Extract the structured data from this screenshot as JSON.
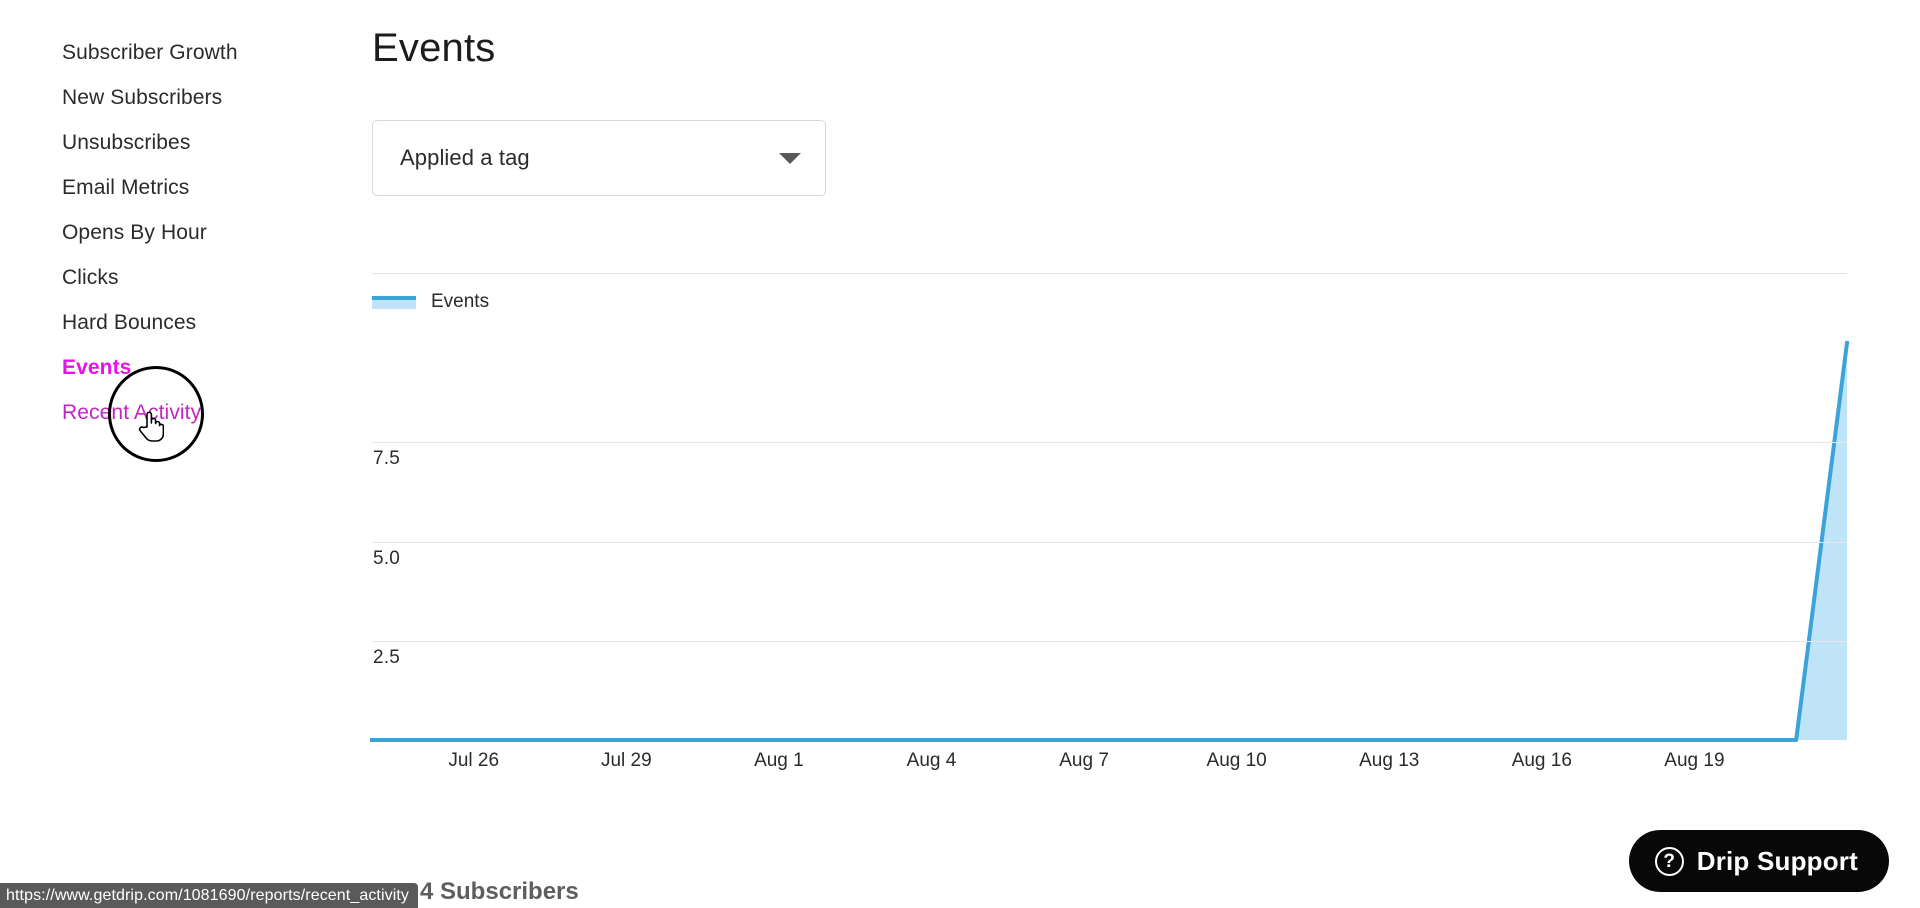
{
  "sidebar": {
    "items": [
      {
        "label": "Subscriber Growth",
        "state": "normal"
      },
      {
        "label": "New Subscribers",
        "state": "normal"
      },
      {
        "label": "Unsubscribes",
        "state": "normal"
      },
      {
        "label": "Email Metrics",
        "state": "normal"
      },
      {
        "label": "Opens By Hour",
        "state": "normal"
      },
      {
        "label": "Clicks",
        "state": "normal"
      },
      {
        "label": "Hard Bounces",
        "state": "normal"
      },
      {
        "label": "Events",
        "state": "active"
      },
      {
        "label": "Recent Activity",
        "state": "visited"
      }
    ]
  },
  "main": {
    "title": "Events",
    "filter": {
      "value": "Applied a tag",
      "caret_icon": "chevron-down-icon"
    }
  },
  "support": {
    "label": "Drip Support",
    "icon": "question-circle-icon",
    "glyph": "?"
  },
  "status": {
    "url": "https://www.getdrip.com/1081690/reports/recent_activity"
  },
  "background": {
    "ghost_text": "4 Subscribers"
  },
  "colors": {
    "accent_magenta": "#e612e6",
    "visited_magenta": "#c425c4",
    "line_blue": "#3aa3d9",
    "fill_blue": "#bfe4f7",
    "grid": "#e6e6e6",
    "support_bg": "#080808"
  },
  "chart_data": {
    "type": "area",
    "title": "Events",
    "xlabel": "",
    "ylabel": "",
    "legend": [
      {
        "name": "Events",
        "color": "#3aa3d9",
        "fill": "#bfe4f7"
      }
    ],
    "legend_position": "top-left",
    "grid": true,
    "ylim": [
      0,
      10
    ],
    "yticks": [
      2.5,
      5.0,
      7.5
    ],
    "ytick_labels": [
      "2.5",
      "5.0",
      "7.5"
    ],
    "xticks": [
      "Jul 26",
      "Jul 29",
      "Aug 1",
      "Aug 4",
      "Aug 7",
      "Aug 10",
      "Aug 13",
      "Aug 16",
      "Aug 19"
    ],
    "x": [
      "Jul 24",
      "Jul 25",
      "Jul 26",
      "Jul 27",
      "Jul 28",
      "Jul 29",
      "Jul 30",
      "Jul 31",
      "Aug 1",
      "Aug 2",
      "Aug 3",
      "Aug 4",
      "Aug 5",
      "Aug 6",
      "Aug 7",
      "Aug 8",
      "Aug 9",
      "Aug 10",
      "Aug 11",
      "Aug 12",
      "Aug 13",
      "Aug 14",
      "Aug 15",
      "Aug 16",
      "Aug 17",
      "Aug 18",
      "Aug 19",
      "Aug 20",
      "Aug 21",
      "Aug 22"
    ],
    "series": [
      {
        "name": "Events",
        "values": [
          0,
          0,
          0,
          0,
          0,
          0,
          0,
          0,
          0,
          0,
          0,
          0,
          0,
          0,
          0,
          0,
          0,
          0,
          0,
          0,
          0,
          0,
          0,
          0,
          0,
          0,
          0,
          0,
          0,
          10
        ]
      }
    ]
  }
}
